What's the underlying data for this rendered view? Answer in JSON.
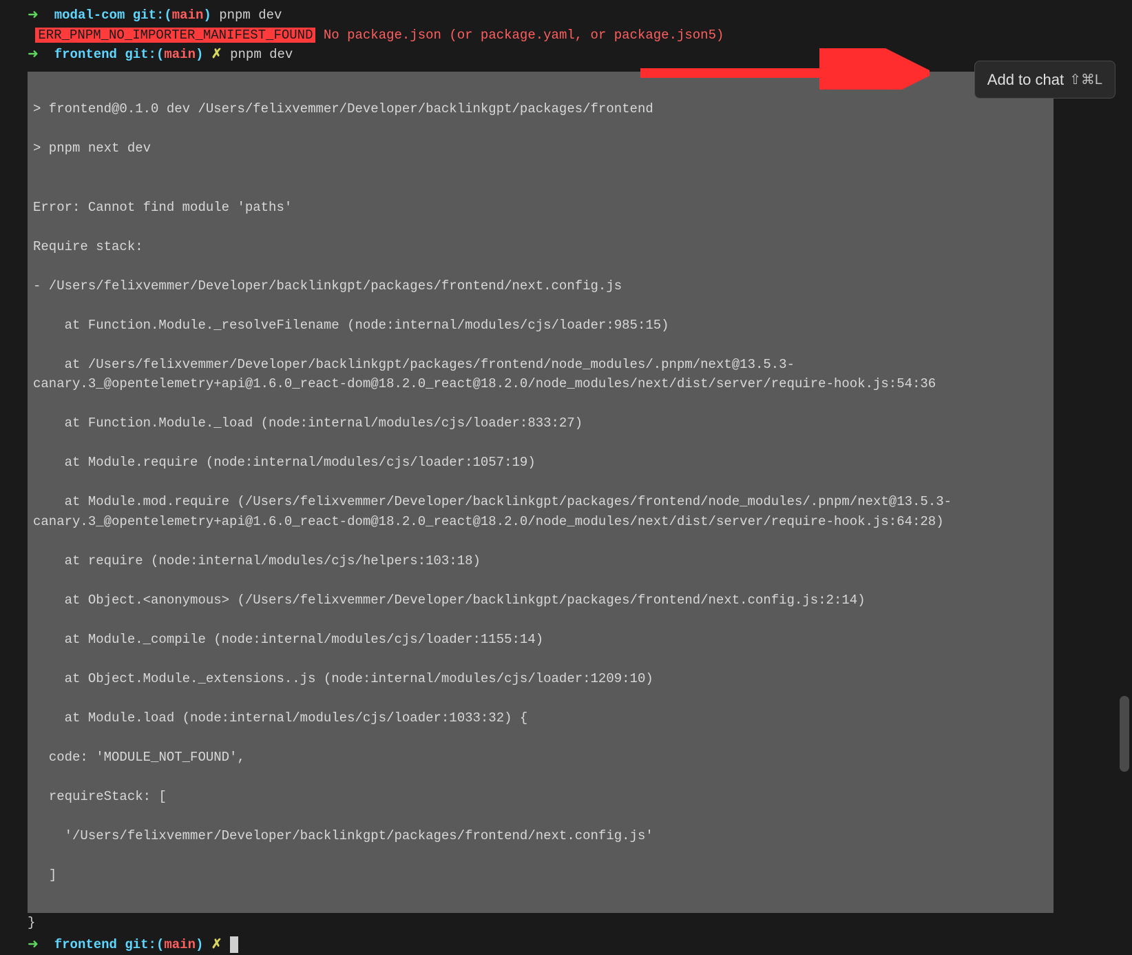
{
  "line1": {
    "arrow": "➜  ",
    "dir": "modal-com",
    "git": " git:(",
    "branch": "main",
    "gitclose": ")",
    "cmd": " pnpm dev"
  },
  "line2": {
    "pad": " ",
    "err": "ERR_PNPM_NO_IMPORTER_MANIFEST_FOUND",
    "msg": " No package.json (or package.yaml, or package.json5)"
  },
  "line3": {
    "arrow": "➜  ",
    "dir": "frontend",
    "git": " git:(",
    "branch": "main",
    "gitclose": ")",
    "dirty": " ✗",
    "cmd": " pnpm dev"
  },
  "selected": {
    "l01": "> frontend@0.1.0 dev /Users/felixvemmer/Developer/backlinkgpt/packages/frontend",
    "l02": "> pnpm next dev",
    "l03": "",
    "l04": "Error: Cannot find module 'paths'",
    "l05": "Require stack:",
    "l06": "- /Users/felixvemmer/Developer/backlinkgpt/packages/frontend/next.config.js",
    "l07": "    at Function.Module._resolveFilename (node:internal/modules/cjs/loader:985:15)",
    "l08": "    at /Users/felixvemmer/Developer/backlinkgpt/packages/frontend/node_modules/.pnpm/next@13.5.3-canary.3_@opentelemetry+api@1.6.0_react-dom@18.2.0_react@18.2.0/node_modules/next/dist/server/require-hook.js:54:36",
    "l09": "    at Function.Module._load (node:internal/modules/cjs/loader:833:27)",
    "l10": "    at Module.require (node:internal/modules/cjs/loader:1057:19)",
    "l11": "    at Module.mod.require (/Users/felixvemmer/Developer/backlinkgpt/packages/frontend/node_modules/.pnpm/next@13.5.3-canary.3_@opentelemetry+api@1.6.0_react-dom@18.2.0_react@18.2.0/node_modules/next/dist/server/require-hook.js:64:28)",
    "l12": "    at require (node:internal/modules/cjs/helpers:103:18)",
    "l13": "    at Object.<anonymous> (/Users/felixvemmer/Developer/backlinkgpt/packages/frontend/next.config.js:2:14)",
    "l14": "    at Module._compile (node:internal/modules/cjs/loader:1155:14)",
    "l15": "    at Object.Module._extensions..js (node:internal/modules/cjs/loader:1209:10)",
    "l16": "    at Module.load (node:internal/modules/cjs/loader:1033:32) {",
    "l17": "  code: 'MODULE_NOT_FOUND',",
    "l18": "  requireStack: [",
    "l19": "    '/Users/felixvemmer/Developer/backlinkgpt/packages/frontend/next.config.js'",
    "l20": "  ]"
  },
  "after": {
    "brace": "}"
  },
  "final": {
    "arrow": "➜  ",
    "dir": "frontend",
    "git": " git:(",
    "branch": "main",
    "gitclose": ")",
    "dirty": " ✗ "
  },
  "button": {
    "label": "Add to chat",
    "shortcut": "⇧⌘L"
  }
}
